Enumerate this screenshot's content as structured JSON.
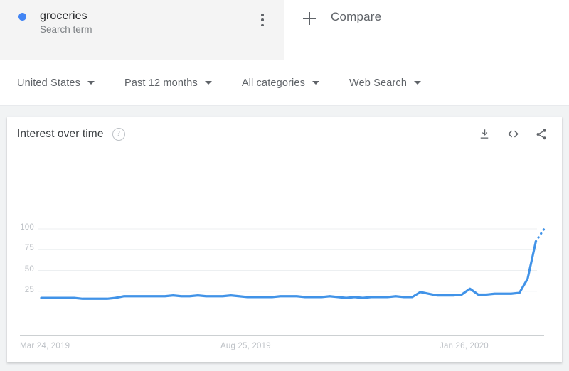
{
  "term": {
    "name": "groceries",
    "subtitle": "Search term",
    "dot_color": "#4285f4",
    "menu_icon": "kebab-menu-icon"
  },
  "compare": {
    "label": "Compare",
    "icon": "plus-icon"
  },
  "filters": [
    {
      "label": "United States",
      "name": "region"
    },
    {
      "label": "Past 12 months",
      "name": "time-range"
    },
    {
      "label": "All categories",
      "name": "category"
    },
    {
      "label": "Web Search",
      "name": "search-type"
    }
  ],
  "card": {
    "title": "Interest over time",
    "help_icon": "help-circle-icon",
    "actions": [
      {
        "name": "download-icon",
        "label": "Download"
      },
      {
        "name": "embed-icon",
        "label": "Embed"
      },
      {
        "name": "share-icon",
        "label": "Share"
      }
    ]
  },
  "chart_data": {
    "type": "line",
    "title": "Interest over time",
    "xlabel": "",
    "ylabel": "",
    "ylim": [
      0,
      100
    ],
    "yticks": [
      25,
      50,
      75,
      100
    ],
    "grid": true,
    "legend": false,
    "series_color": "#4193e8",
    "x_tick_labels": [
      "Mar 24, 2019",
      "Aug 25, 2019",
      "Jan 26, 2020"
    ],
    "x_tick_positions": [
      0,
      22,
      44
    ],
    "series": [
      {
        "name": "groceries",
        "values": [
          17,
          17,
          17,
          17,
          17,
          16,
          16,
          16,
          16,
          17,
          19,
          19,
          19,
          19,
          19,
          19,
          20,
          19,
          19,
          20,
          19,
          19,
          19,
          20,
          19,
          18,
          18,
          18,
          18,
          19,
          19,
          19,
          18,
          18,
          18,
          19,
          18,
          17,
          18,
          17,
          18,
          18,
          18,
          19,
          18,
          18,
          24,
          22,
          20,
          20,
          20,
          21,
          28,
          21,
          21,
          22,
          22,
          22,
          23,
          40,
          85,
          100
        ]
      }
    ],
    "partial_from_index": 60,
    "partial_note": "trailing dotted segment indicates incomplete data"
  }
}
